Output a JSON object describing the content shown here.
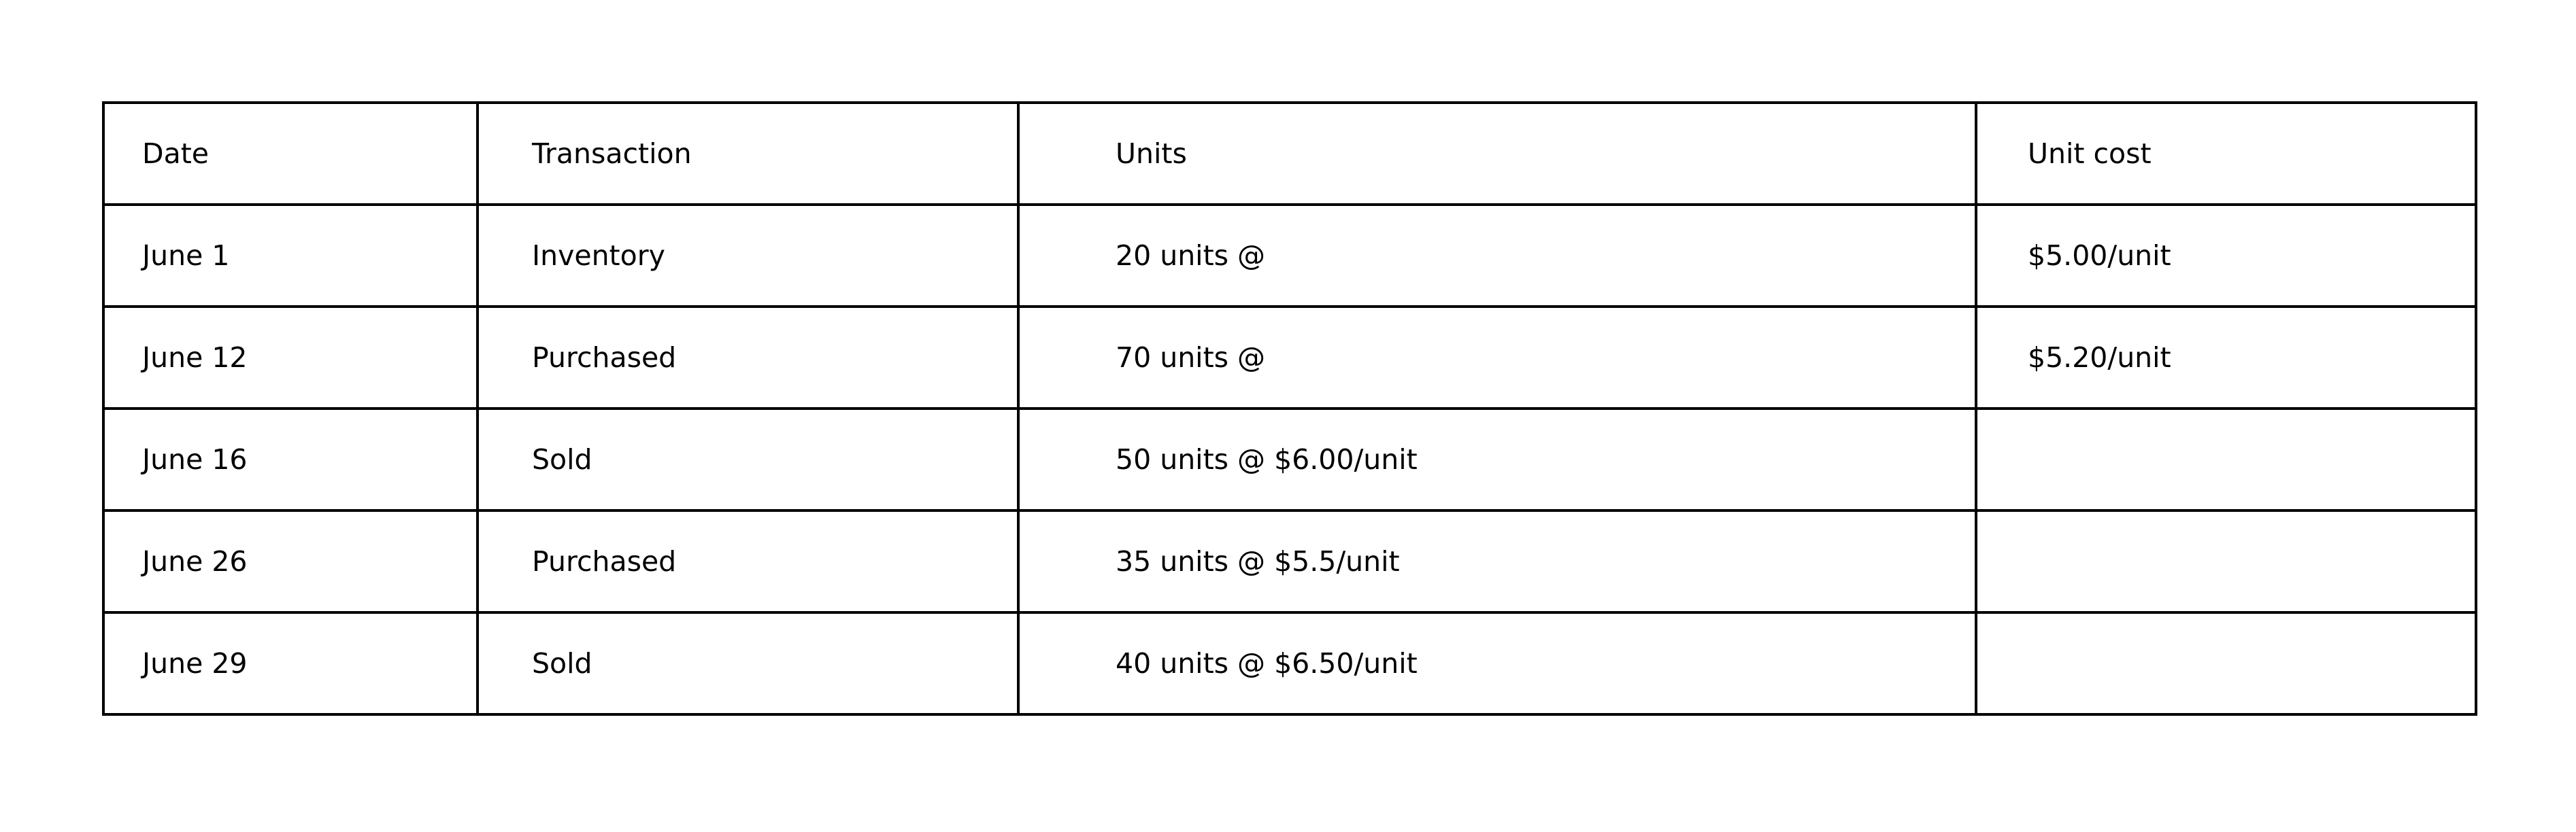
{
  "table": {
    "headers": [
      "Date",
      "Transaction",
      "Units",
      "Unit cost"
    ],
    "rows": [
      [
        "June 1",
        "Inventory",
        "20 units @",
        "$5.00/unit"
      ],
      [
        "June 12",
        "Purchased",
        "70 units @",
        "$5.20/unit"
      ],
      [
        "June 16",
        "Sold",
        "50 units @ $6.00/unit",
        ""
      ],
      [
        "June 26",
        "Purchased",
        "35 units @ $5.5/unit",
        ""
      ],
      [
        "June 29",
        "Sold",
        "40 units @ $6.50/unit",
        ""
      ]
    ]
  }
}
